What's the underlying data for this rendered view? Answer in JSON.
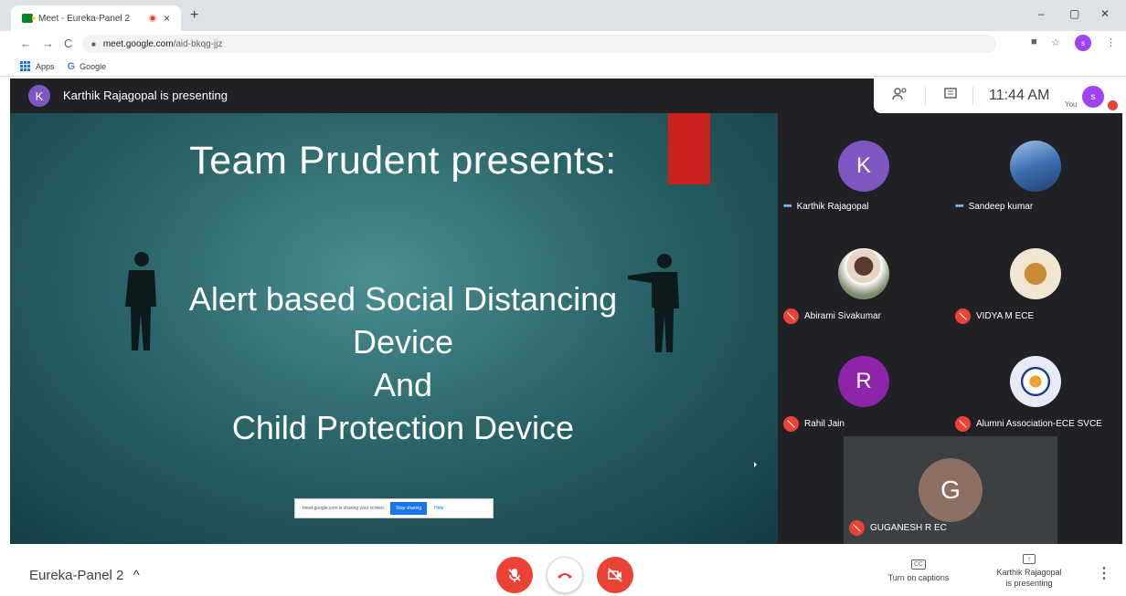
{
  "browser": {
    "tab_title": "Meet - Eureka-Panel 2",
    "tab_close": "×",
    "new_tab": "+",
    "minimize": "–",
    "restore": "▢",
    "close": "✕",
    "back": "←",
    "forward": "→",
    "reload": "C",
    "url_host": "meet.google.com",
    "url_path": "/aid-bkqg-jjz",
    "bookmarks": {
      "apps": "Apps",
      "google": "Google",
      "google_letter": "G"
    },
    "profile_initial": "s"
  },
  "meet": {
    "presenter_initial": "K",
    "presenting_banner": "Karthik Rajagopal is presenting",
    "time": "11:44 AM",
    "you_label": "You",
    "self_initial": "s",
    "slide": {
      "title": "Team Prudent presents:",
      "line1": "Alert based Social Distancing",
      "line2": "Device",
      "line3": "And",
      "line4": "Child Protection Device",
      "share_notice": "meet.google.com is sharing your screen.",
      "stop_sharing": "Stop sharing",
      "hide": "Hide"
    },
    "participants": [
      {
        "initial": "K",
        "name": "Karthik Rajagopal",
        "color": "#7e57c2",
        "state": "speaking"
      },
      {
        "initial": "",
        "name": "Sandeep kumar",
        "color": "#4a7fbf",
        "state": "speaking"
      },
      {
        "initial": "",
        "name": "Abirami Sivakumar",
        "color": "#9aa0a6",
        "state": "muted"
      },
      {
        "initial": "",
        "name": "VIDYA M ECE",
        "color": "#f1e6d2",
        "state": "muted"
      },
      {
        "initial": "R",
        "name": "Rahil Jain",
        "color": "#8e24aa",
        "state": "muted"
      },
      {
        "initial": "",
        "name": "Alumni Association-ECE SVCE",
        "color": "#e8eaf6",
        "state": "muted"
      }
    ],
    "featured": {
      "initial": "G",
      "name": "GUGANESH R EC",
      "color": "#8d6e63"
    },
    "bottom": {
      "meeting_name": "Eureka-Panel 2",
      "expand_caret": "^",
      "captions_icon": "CC",
      "captions_label": "Turn on captions",
      "presenting_line1": "Karthik Rajagopal",
      "presenting_line2": "is presenting",
      "more": "⋮"
    }
  },
  "icons": [
    "meet-favicon",
    "record-icon",
    "lock-icon",
    "apps-icon",
    "camera-icon",
    "star-icon",
    "people-icon",
    "chat-icon",
    "mic-off-icon",
    "hangup-icon",
    "camera-off-icon",
    "captions-icon",
    "present-icon",
    "more-icon"
  ]
}
